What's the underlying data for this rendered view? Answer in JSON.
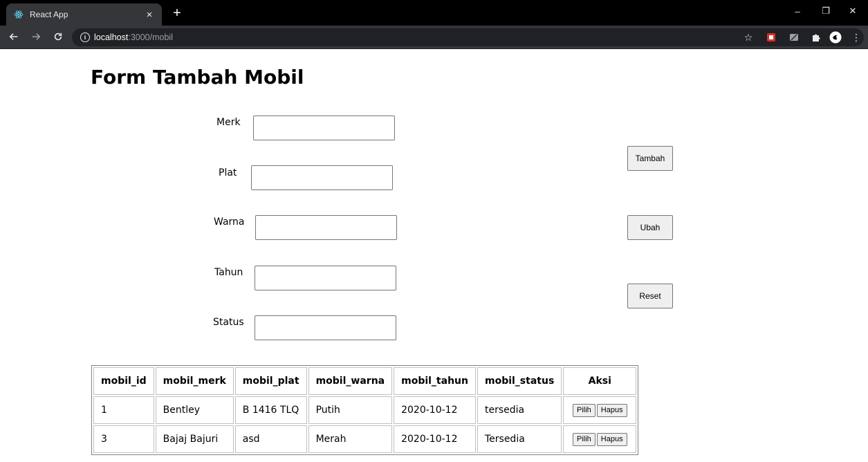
{
  "browser": {
    "tab_title": "React App",
    "tab_close": "×",
    "new_tab": "+",
    "url_host": "localhost",
    "url_path": ":3000/mobil",
    "window_controls": [
      "–",
      "❐",
      "✕"
    ]
  },
  "page": {
    "title": "Form Tambah Mobil"
  },
  "form": {
    "fields": [
      {
        "label": "Merk",
        "value": ""
      },
      {
        "label": "Plat",
        "value": ""
      },
      {
        "label": "Warna",
        "value": ""
      },
      {
        "label": "Tahun",
        "value": ""
      },
      {
        "label": "Status",
        "value": ""
      }
    ],
    "buttons": {
      "tambah": "Tambah",
      "ubah": "Ubah",
      "reset": "Reset"
    }
  },
  "table": {
    "headers": [
      "mobil_id",
      "mobil_merk",
      "mobil_plat",
      "mobil_warna",
      "mobil_tahun",
      "mobil_status",
      "Aksi"
    ],
    "rows": [
      {
        "id": "1",
        "merk": "Bentley",
        "plat": "B 1416 TLQ",
        "warna": "Putih",
        "tahun": "2020-10-12",
        "status": "tersedia",
        "pilih": "Pilih",
        "hapus": "Hapus"
      },
      {
        "id": "3",
        "merk": "Bajaj Bajuri",
        "plat": "asd",
        "warna": "Merah",
        "tahun": "2020-10-12",
        "status": "Tersedia",
        "pilih": "Pilih",
        "hapus": "Hapus"
      }
    ]
  },
  "colors": {
    "chrome_dark": "#000000",
    "chrome_toolbar": "#35363a",
    "omnibox": "#202124",
    "react_blue": "#61dafb"
  },
  "icons": [
    "react-logo-icon",
    "back-arrow-icon",
    "forward-arrow-icon",
    "reload-icon",
    "info-icon",
    "star-icon",
    "puzzle-extension-icon",
    "profile-avatar-icon",
    "kebab-menu-icon"
  ]
}
